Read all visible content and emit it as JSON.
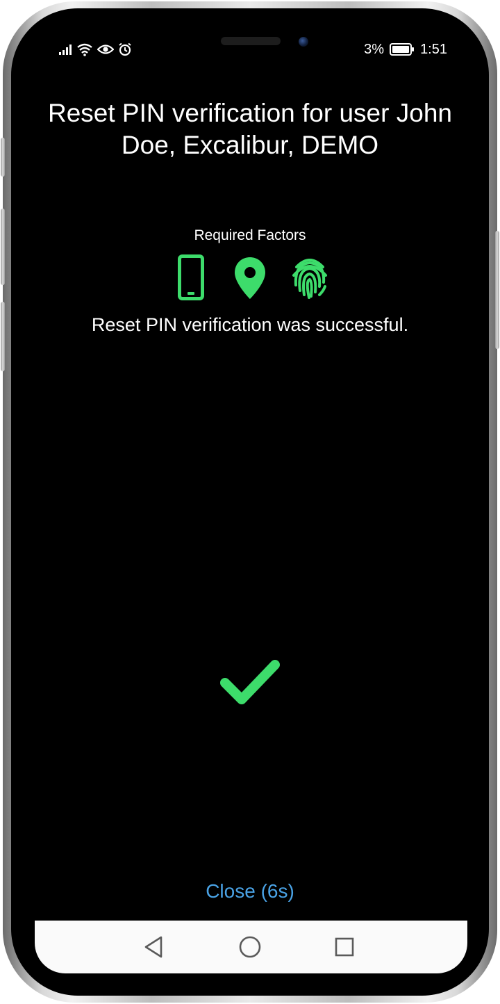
{
  "status_bar": {
    "battery_percent": "3%",
    "time": "1:51",
    "icons": [
      "signal-icon",
      "wifi-icon",
      "eye-icon",
      "alarm-icon",
      "battery-icon"
    ]
  },
  "screen": {
    "title": "Reset PIN verification for user John Doe, Excalibur, DEMO",
    "required_factors_label": "Required Factors",
    "factors": [
      "phone-icon",
      "location-pin-icon",
      "fingerprint-icon"
    ],
    "message": "Reset PIN verification was successful.",
    "success_icon": "checkmark-icon",
    "close_label": "Close (6s)"
  },
  "nav_bar": {
    "buttons": [
      "back-icon",
      "home-icon",
      "recents-icon"
    ]
  },
  "colors": {
    "accent_green": "#3ddc6b",
    "link_blue": "#4aa3e6",
    "background": "#000000",
    "nav_background": "#fafafa"
  }
}
